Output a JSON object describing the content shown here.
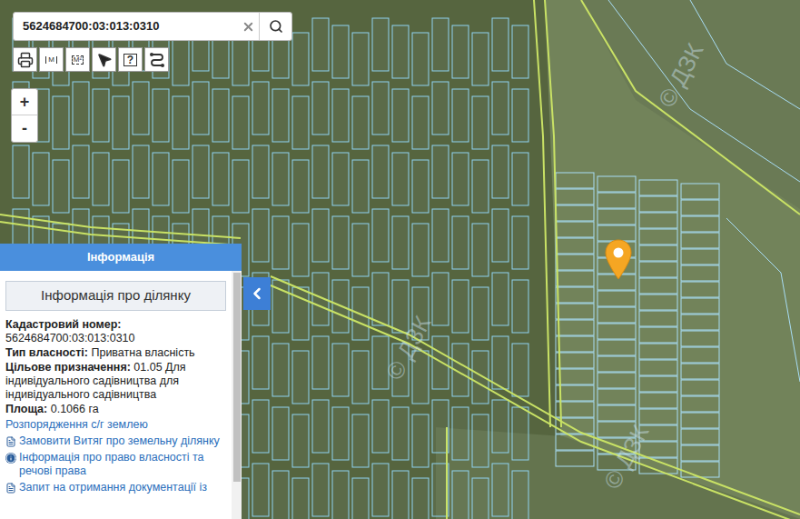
{
  "search": {
    "value": "5624684700:03:013:0310"
  },
  "toolbar": {
    "distance_label": "M",
    "area_label": "M²",
    "help_label": "?"
  },
  "zoom": {
    "in": "+",
    "out": "-"
  },
  "map": {
    "watermark": "© ДЗК"
  },
  "panel": {
    "title": "Інформація",
    "section": "Інформація про ділянку",
    "fields": [
      {
        "label": "Кадастровий номер:",
        "value": "5624684700:03:013:0310",
        "kind": "stacked"
      },
      {
        "label": "Тип власності:",
        "value": "Приватна власність",
        "kind": "inline"
      },
      {
        "label": "Цільове призначення:",
        "value": "01.05 Для індивідуального садівництва для індивідуального садівництва",
        "kind": "inline"
      },
      {
        "label": "Площа:",
        "value": "0.1066 га",
        "kind": "inline"
      }
    ],
    "links": [
      {
        "text": "Розпорядження с/г землею",
        "kind": "plain"
      },
      {
        "text": "Замовити Витяг про земельну ділянку",
        "kind": "document"
      },
      {
        "text": "Інформація про право власності та речові права",
        "kind": "info"
      },
      {
        "text": "Запит на отримання документації із",
        "kind": "document"
      }
    ]
  }
}
